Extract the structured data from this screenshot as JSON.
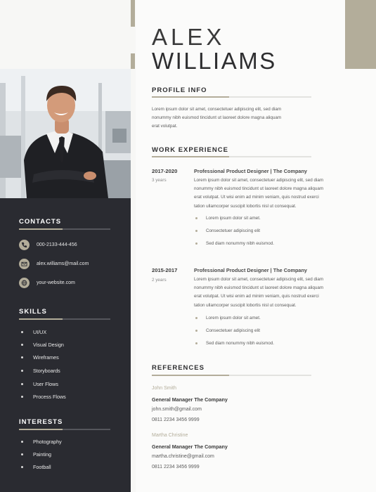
{
  "name": {
    "first": "ALEX",
    "last": "WILLIAMS"
  },
  "colors": {
    "accent": "#b3ad9a",
    "sidebar": "#2a2b31",
    "text": "#2e2e30"
  },
  "contacts": {
    "heading": "CONTACTS",
    "items": [
      {
        "icon": "phone-icon",
        "text": "000-2133-444-456"
      },
      {
        "icon": "mail-icon",
        "text": "alex.williams@mail.com"
      },
      {
        "icon": "globe-icon",
        "text": "your-website.com"
      }
    ]
  },
  "skills": {
    "heading": "SKILLS",
    "items": [
      "UI/UX",
      "Visual Design",
      "Wireframes",
      "Storyboards",
      "User Flows",
      "Process Flows"
    ]
  },
  "interests": {
    "heading": "INTERESTS",
    "items": [
      "Photography",
      "Painting",
      "Football"
    ]
  },
  "profile": {
    "heading": "PROFILE INFO",
    "lines": [
      "Lorem ipsum dolor sit amet, consectetuer adipiscing elit, sed diam",
      "nonummy nibh euismod tincidunt ut laoreet dolore magna aliquam",
      "erat volutpat."
    ]
  },
  "experience": {
    "heading": "WORK EXPERIENCE",
    "jobs": [
      {
        "years": "2017-2020",
        "duration": "3 years",
        "title": "Professional Product Designer | The Company",
        "lines": [
          "Lorem ipsum dolor sit amet, consectetuer adipiscing elit, sed diam",
          "nonummy nibh euismod tincidunt ut laoreet dolore magna aliquam",
          "erat volutpat. Ut wisi enim ad minim veniam, quis nostrud exerci",
          "tation ullamcorper suscipit lobortis nisl ut consequat."
        ],
        "bullets": [
          "Lorem ipsum dolor sit amet.",
          "Consectetuer adipiscing elit",
          "Sed diam nonummy nibh euismod."
        ]
      },
      {
        "years": "2015-2017",
        "duration": "2 years",
        "title": "Professional Product Designer | The Company",
        "lines": [
          "Lorem ipsum dolor sit amet, consectetuer adipiscing elit, sed diam",
          "nonummy nibh euismod tincidunt ut laoreet dolore magna aliquam",
          "erat volutpat. Ut wisi enim ad minim veniam, quis nostrud exerci",
          "tation ullamcorper suscipit lobortis nisl ut consequat."
        ],
        "bullets": [
          "Lorem ipsum dolor sit amet.",
          "Consectetuer adipiscing elit",
          "Sed diam nonummy nibh euismod."
        ]
      }
    ]
  },
  "references": {
    "heading": "REFERENCES",
    "items": [
      {
        "name": "John Smith",
        "title": "General Manager The Company",
        "email": "john.smith@gmail.com",
        "phone": "0811 2234 3456 9999"
      },
      {
        "name": "Martha Christine",
        "title": "General Manager The Company",
        "email": "martha.christine@gmail.com",
        "phone": "0811 2234 3456 9999"
      }
    ]
  }
}
